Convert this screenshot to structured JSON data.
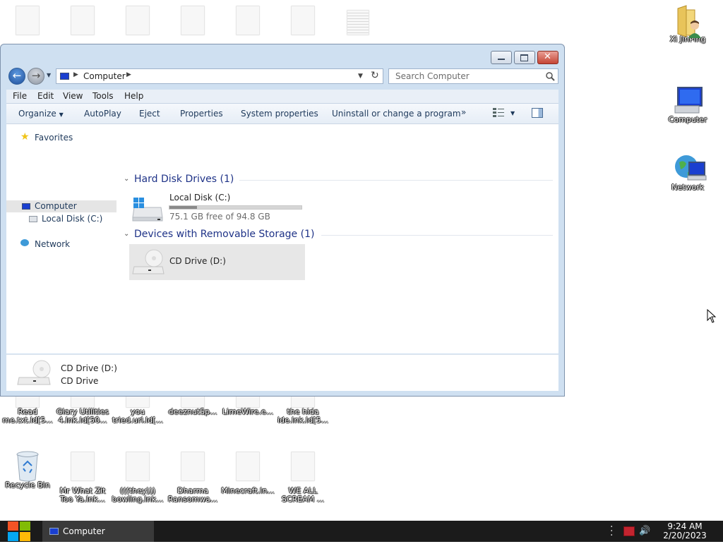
{
  "desktop": {
    "top_row_icons": [
      "",
      "",
      "",
      "",
      "",
      "",
      ""
    ],
    "right_icons": [
      {
        "label": "Xi JinPing",
        "icon": "user-folder-icon"
      },
      {
        "label": "Computer",
        "icon": "computer-icon"
      },
      {
        "label": "Network",
        "icon": "network-icon"
      }
    ],
    "row2_icons": [
      {
        "label": "Read\nme.txt.ld[5...",
        "icon": "document-icon"
      },
      {
        "label": "Glary Utilities\n4.lnk.ld[50...",
        "icon": "document-icon"
      },
      {
        "label": "you\ntried.url.ld[...",
        "icon": "document-icon"
      },
      {
        "label": "deeznutSp...",
        "icon": "document-icon"
      },
      {
        "label": "LimeWire.e...",
        "icon": "document-icon"
      },
      {
        "label": "the hida\nide.lnk.ld[5...",
        "icon": "document-icon"
      }
    ],
    "row3_icons": [
      {
        "label": "Recycle Bin",
        "icon": "recycle-bin-icon"
      },
      {
        "label": "Mr What Zit\nToo Ya.lnk...",
        "icon": "document-icon"
      },
      {
        "label": "(((they)))\nbowling.lnk...",
        "icon": "document-icon"
      },
      {
        "label": "Dharma\nRansomwa...",
        "icon": "document-icon"
      },
      {
        "label": "Minecraft.ln...",
        "icon": "document-icon"
      },
      {
        "label": "WE ALL\nSCREAM ...",
        "icon": "document-icon"
      }
    ]
  },
  "window": {
    "title": "Computer",
    "address": {
      "crumb": "Computer"
    },
    "search_placeholder": "Search Computer",
    "menu": [
      "File",
      "Edit",
      "View",
      "Tools",
      "Help"
    ],
    "toolbar": [
      "Organize",
      "AutoPlay",
      "Eject",
      "Properties",
      "System properties",
      "Uninstall or change a program",
      "»"
    ],
    "nav": {
      "favorites": "Favorites",
      "computer": "Computer",
      "local_disk": "Local Disk (C:)",
      "network": "Network"
    },
    "groups": {
      "hdd": "Hard Disk Drives (1)",
      "removable": "Devices with Removable Storage (1)"
    },
    "drives": {
      "c_name": "Local Disk (C:)",
      "c_free": "75.1 GB free of 94.8 GB",
      "c_used_fraction": 0.208,
      "d_name": "CD Drive (D:)"
    },
    "details": {
      "name": "CD Drive (D:)",
      "type": "CD Drive"
    }
  },
  "taskbar": {
    "task_label": "Computer",
    "time": "9:24 AM",
    "date": "2/20/2023"
  }
}
